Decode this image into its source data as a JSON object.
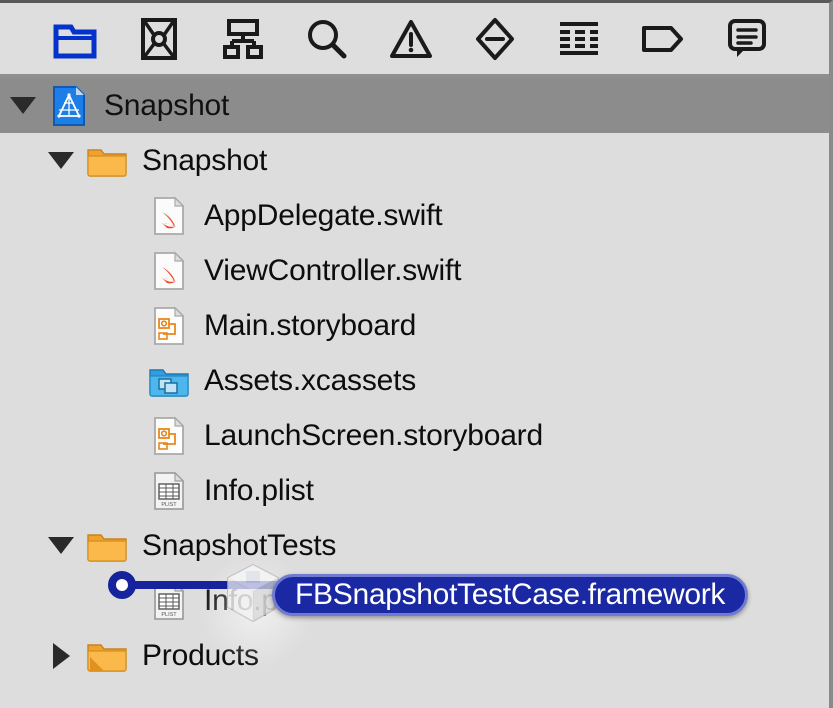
{
  "toolbar": {
    "items": [
      {
        "icon": "folder-icon",
        "label": "Project navigator",
        "selected": true
      },
      {
        "icon": "source-control-icon",
        "label": "Source control navigator",
        "selected": false
      },
      {
        "icon": "hierarchy-icon",
        "label": "Symbol navigator",
        "selected": false
      },
      {
        "icon": "search-icon",
        "label": "Find navigator",
        "selected": false
      },
      {
        "icon": "warning-icon",
        "label": "Issue navigator",
        "selected": false
      },
      {
        "icon": "test-diamond-icon",
        "label": "Test navigator",
        "selected": false
      },
      {
        "icon": "debug-list-icon",
        "label": "Debug navigator",
        "selected": false
      },
      {
        "icon": "breakpoint-tag-icon",
        "label": "Breakpoint navigator",
        "selected": false
      },
      {
        "icon": "report-speech-icon",
        "label": "Report navigator",
        "selected": false
      }
    ]
  },
  "tree": {
    "rows": [
      {
        "label": "Snapshot",
        "icon": "xcode-project-icon",
        "twisty": "down",
        "indent": 0,
        "selected": true
      },
      {
        "label": "Snapshot",
        "icon": "folder-orange-icon",
        "twisty": "down",
        "indent": 1,
        "selected": false
      },
      {
        "label": "AppDelegate.swift",
        "icon": "swift-file-icon",
        "twisty": "none",
        "indent": 2,
        "selected": false
      },
      {
        "label": "ViewController.swift",
        "icon": "swift-file-icon",
        "twisty": "none",
        "indent": 2,
        "selected": false
      },
      {
        "label": "Main.storyboard",
        "icon": "storyboard-icon",
        "twisty": "none",
        "indent": 2,
        "selected": false
      },
      {
        "label": "Assets.xcassets",
        "icon": "xcassets-icon",
        "twisty": "none",
        "indent": 2,
        "selected": false
      },
      {
        "label": "LaunchScreen.storyboard",
        "icon": "storyboard-icon",
        "twisty": "none",
        "indent": 2,
        "selected": false
      },
      {
        "label": "Info.plist",
        "icon": "plist-icon",
        "twisty": "none",
        "indent": 2,
        "selected": false
      },
      {
        "label": "SnapshotTests",
        "icon": "folder-orange-icon",
        "twisty": "down",
        "indent": 1,
        "selected": false
      },
      {
        "label": "Info.plist",
        "icon": "plist-icon",
        "twisty": "none",
        "indent": 2,
        "selected": false
      },
      {
        "label": "Products",
        "icon": "folder-orange-icon",
        "twisty": "right",
        "indent": 1,
        "selected": false
      }
    ]
  },
  "drag": {
    "pill_label": "FBSnapshotTestCase.framework",
    "cube_icon": "framework-cube-icon",
    "drop_indicator": "insertion-point"
  },
  "colors": {
    "background": "#dddddd",
    "selection": "#8c8c8c",
    "drag_pill": "#1a28a3",
    "drop_line": "#16239c",
    "folder_orange": "#f5a623",
    "accent_blue": "#0433cc"
  }
}
